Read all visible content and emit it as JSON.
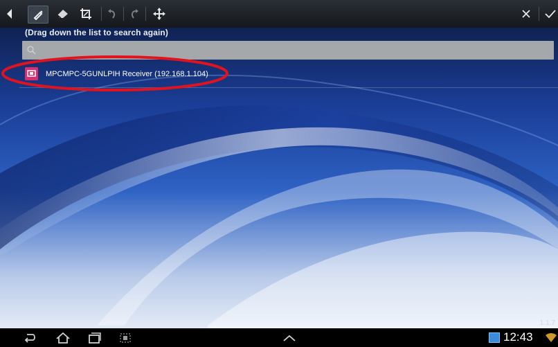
{
  "toolbar": {
    "icons": [
      "back-arrow-icon",
      "pen-icon",
      "eraser-icon",
      "crop-icon",
      "undo-icon",
      "redo-icon",
      "move-icon",
      "close-icon",
      "check-icon"
    ]
  },
  "hint": "(Drag down the list to search again)",
  "search": {
    "placeholder": ""
  },
  "receivers": [
    {
      "label": "MPCMPC-5GUNLPIH Receiver (192.168.1.104)",
      "icon": "screen-mirroring-icon"
    }
  ],
  "version": "1.1.7",
  "status_bar": {
    "time": "12:43",
    "nav_icons": [
      "back-icon",
      "home-icon",
      "recent-apps-icon",
      "screenshot-icon",
      "up-chevron-icon"
    ]
  },
  "colors": {
    "annotation_ellipse": "#e0141e",
    "receiver_icon": "#d6306f",
    "search_bar": "#a4a8ab"
  }
}
